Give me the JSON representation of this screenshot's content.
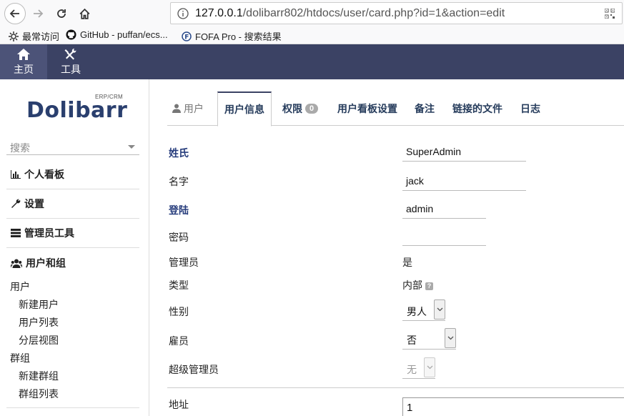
{
  "browser": {
    "url_host": "127.0.0.1",
    "url_path": "/dolibarr802/htdocs/user/card.php?id=1&action=edit",
    "bookmarks": [
      {
        "icon": "gear-icon",
        "label": "最常访问"
      },
      {
        "icon": "github-icon",
        "label": "GitHub - puffan/ecs..."
      },
      {
        "icon": "fofa-icon",
        "label": "FOFA Pro - 搜索结果"
      }
    ]
  },
  "topbar": {
    "home_label": "主页",
    "tools_label": "工具"
  },
  "sidebar": {
    "logo_erp": "ERP/CRM",
    "logo_text": "Dolibarr",
    "search_placeholder": "搜索",
    "menu": {
      "dashboard": "个人看板",
      "setup": "设置",
      "admin_tools": "管理员工具",
      "users_groups": "用户和组",
      "users": "用户",
      "new_user": "新建用户",
      "user_list": "用户列表",
      "hierarchy": "分层视图",
      "groups": "群组",
      "new_group": "新建群组",
      "group_list": "群组列表"
    }
  },
  "tabs": {
    "user": "用户",
    "user_info": "用户信息",
    "permissions": "权限",
    "permissions_count": "0",
    "dashboard_setup": "用户看板设置",
    "note": "备注",
    "linked_files": "链接的文件",
    "log": "日志"
  },
  "form": {
    "lastname_label": "姓氏",
    "lastname_value": "SuperAdmin",
    "firstname_label": "名字",
    "firstname_value": "jack",
    "login_label": "登陆",
    "login_value": "admin",
    "password_label": "密码",
    "password_value": "",
    "admin_label": "管理员",
    "admin_value": "是",
    "type_label": "类型",
    "type_value": "内部",
    "gender_label": "性别",
    "gender_value": "男人",
    "employee_label": "雇员",
    "employee_value": "否",
    "superadmin_label": "超级管理员",
    "superadmin_value": "无",
    "address_label": "地址",
    "address_value": "1"
  },
  "colors": {
    "topbar": "#3b4264",
    "topbar_active": "#4c5378",
    "link": "#263c5c",
    "required_label": "#263c7c"
  }
}
